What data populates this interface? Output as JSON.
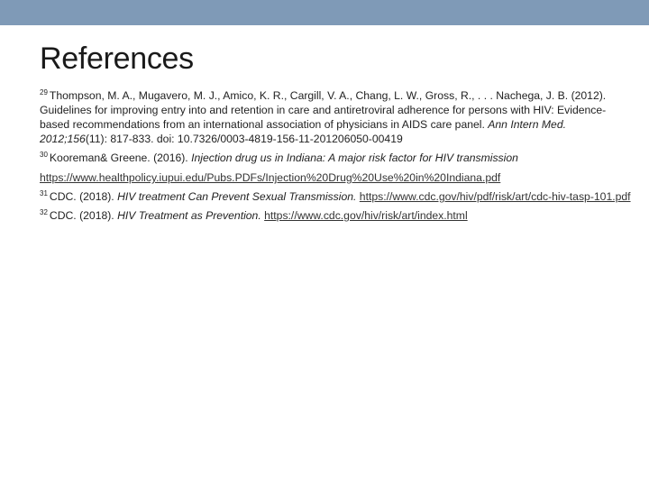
{
  "slide": {
    "title": "References",
    "refs": [
      {
        "num": "29",
        "text": "Thompson, M. A., Mugavero, M. J., Amico, K. R., Cargill, V. A., Chang, L. W., Gross, R., . . . Nachega, J. B. (2012). Guidelines for improving entry into and retention in care and antiretroviral adherence for persons with HIV: Evidence-based recommendations from an international association of physicians in AIDS care panel. ",
        "journal": "Ann Intern Med. 2012;156",
        "rest": "(11): 817-833. doi: 10.7326/0003-4819-156-11-201206050-00419"
      },
      {
        "num": "30",
        "text": "Kooreman& Greene. (2016). ",
        "title_italic": "Injection drug us in Indiana: A major risk factor for HIV transmission",
        "link": "https://www.healthpolicy.iupui.edu/Pubs.PDFs/Injection%20Drug%20Use%20in%20Indiana.pdf"
      },
      {
        "num": "31",
        "text": "CDC. (2018). ",
        "title_italic": "HIV treatment Can Prevent Sexual Transmission.",
        "link": "https://www.cdc.gov/hiv/pdf/risk/art/cdc-hiv-tasp-101.pdf"
      },
      {
        "num": "32",
        "text": "CDC. (2018). ",
        "title_italic": "HIV Treatment as Prevention.",
        "link": "https://www.cdc.gov/hiv/risk/art/index.html"
      }
    ]
  }
}
